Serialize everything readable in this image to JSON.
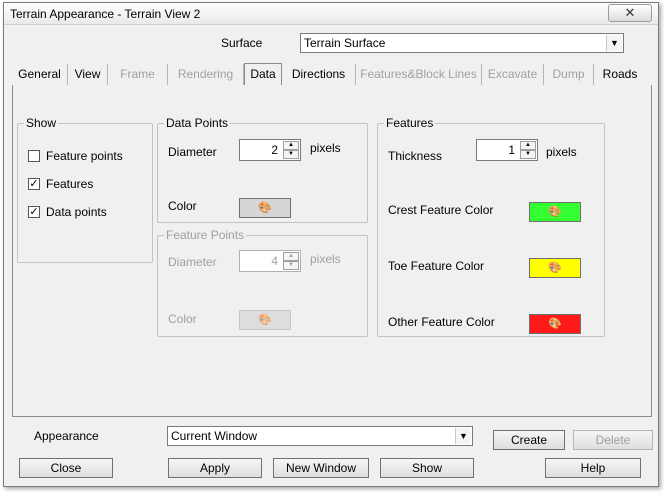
{
  "window": {
    "title": "Terrain Appearance - Terrain View 2",
    "close_glyph": "✕"
  },
  "surface": {
    "label": "Surface",
    "value": "Terrain Surface"
  },
  "tabs": [
    {
      "label": "General"
    },
    {
      "label": "View"
    },
    {
      "label": "Frame"
    },
    {
      "label": "Rendering"
    },
    {
      "label": "Data"
    },
    {
      "label": "Directions"
    },
    {
      "label": "Features&Block Lines"
    },
    {
      "label": "Excavate"
    },
    {
      "label": "Dump"
    },
    {
      "label": "Roads"
    }
  ],
  "show": {
    "legend": "Show",
    "feature_points": {
      "label": "Feature points",
      "checked": ""
    },
    "features": {
      "label": "Features",
      "checked": "✓"
    },
    "data_points": {
      "label": "Data points",
      "checked": "✓"
    }
  },
  "data_points": {
    "legend": "Data Points",
    "diameter_label": "Diameter",
    "diameter_value": "2",
    "unit": "pixels",
    "color_label": "Color"
  },
  "feature_points": {
    "legend": "Feature Points",
    "diameter_label": "Diameter",
    "diameter_value": "4",
    "unit": "pixels",
    "color_label": "Color"
  },
  "features": {
    "legend": "Features",
    "thickness_label": "Thickness",
    "thickness_value": "1",
    "unit": "pixels",
    "crest_label": "Crest  Feature Color",
    "toe_label": "Toe Feature Color",
    "other_label": "Other Feature Color"
  },
  "colors": {
    "crest": "#33ff33",
    "toe": "#ffff00",
    "other": "#ff1a1a",
    "data_point": "#d6d6d6"
  },
  "appearance": {
    "label": "Appearance",
    "value": "Current Window"
  },
  "buttons": {
    "create": "Create",
    "delete": "Delete",
    "close": "Close",
    "apply": "Apply",
    "new_window": "New Window",
    "show": "Show",
    "help": "Help"
  },
  "glyphs": {
    "dropdown": "▼",
    "spin_up": "▲",
    "spin_down": "▼",
    "palette": "🎨"
  }
}
